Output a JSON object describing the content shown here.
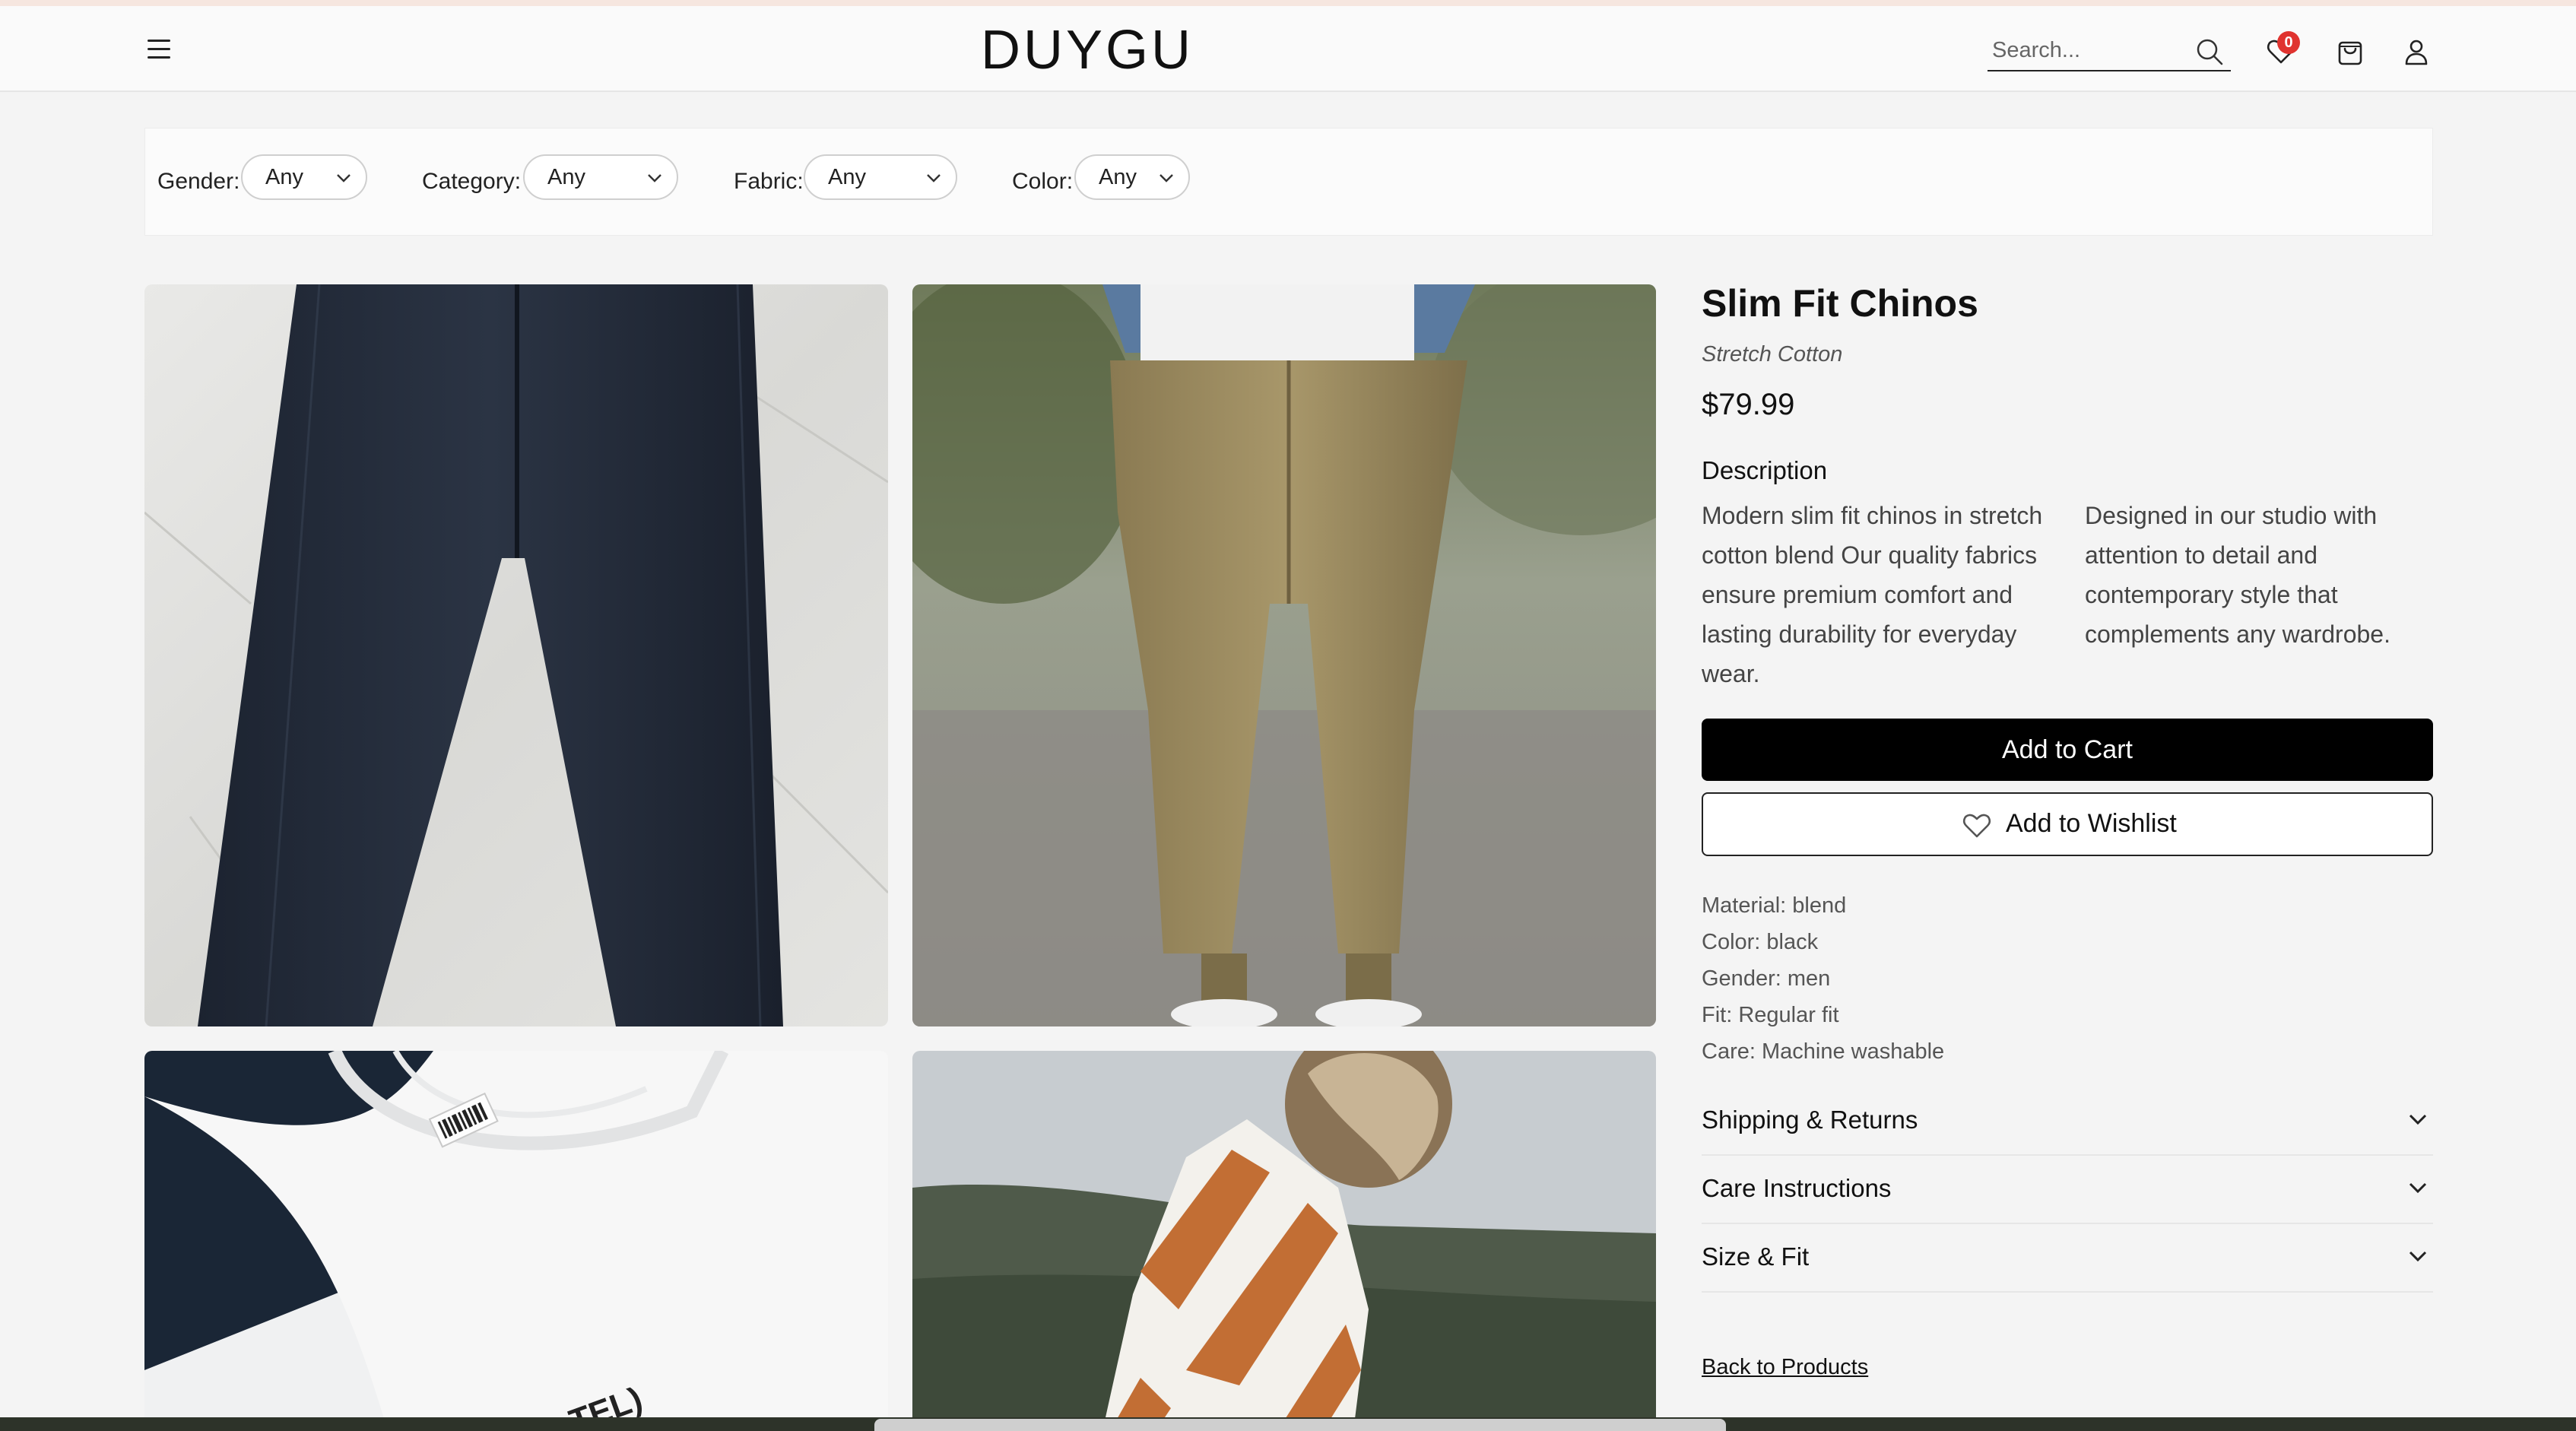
{
  "app": {
    "logo": "DUYGU"
  },
  "header": {
    "search_placeholder": "Search...",
    "wishlist_count": "0",
    "icons": [
      "menu-icon",
      "search-icon",
      "heart-icon",
      "shopping-bag-icon",
      "user-icon"
    ]
  },
  "filters": [
    {
      "label": "Gender:",
      "value": "Any"
    },
    {
      "label": "Category:",
      "value": "Any"
    },
    {
      "label": "Fabric:",
      "value": "Any"
    },
    {
      "label": "Color:",
      "value": "Any"
    }
  ],
  "product": {
    "title": "Slim Fit Chinos",
    "subtitle": "Stretch Cotton",
    "price": "$79.99",
    "description_heading": "Description",
    "description_col1": "Modern slim fit chinos in stretch cotton blend Our quality fabrics ensure premium comfort and lasting durability for everyday wear.",
    "description_col2": "Designed in our studio with attention to detail and contemporary style that complements any wardrobe.",
    "add_to_cart": "Add to Cart",
    "add_to_wishlist": "Add to Wishlist",
    "specs": [
      "Material: blend",
      "Color: black",
      "Gender: men",
      "Fit: Regular fit",
      "Care: Machine washable"
    ],
    "accordions": [
      "Shipping & Returns",
      "Care Instructions",
      "Size & Fit"
    ],
    "back_link": "Back to Products"
  },
  "gallery": {
    "images": [
      "dark-jeans-photo",
      "khaki-chinos-photo",
      "white-tshirt-photo",
      "striped-sweater-photo"
    ],
    "tshirt_print_text": "TEL)"
  },
  "colors": {
    "accent": "#000000",
    "badge": "#e0332f",
    "background": "#f4f4f4"
  }
}
